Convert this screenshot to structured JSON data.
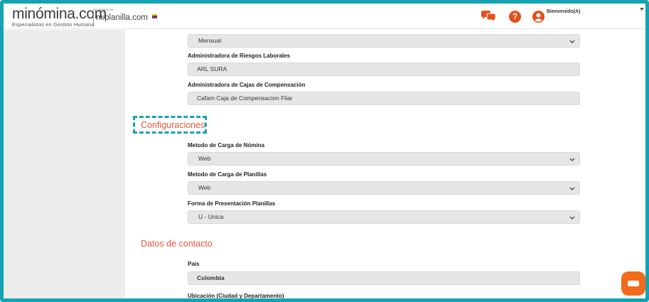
{
  "header": {
    "brand_name": "minómina.com",
    "brand_tagline": "Especialistas en Gestión Humana",
    "powered_label": "POWERED BY",
    "powered_name": "miplanilla.com",
    "welcome": "Bienvenido(A)"
  },
  "fields": {
    "frecuencia": {
      "value": "Mensual"
    },
    "arl": {
      "label": "Administradora de Riesgos Laborales",
      "value": "ARL SURA"
    },
    "caja": {
      "label": "Administradora de Cajas de Compensación",
      "value": "Cafam Caja de Compensacion Fliar"
    },
    "carga_nomina": {
      "label": "Metodo de Carga de Nómina",
      "value": "Web"
    },
    "carga_planillas": {
      "label": "Metodo de Carga de Planillas",
      "value": "Web"
    },
    "forma_presentacion": {
      "label": "Forma de Presentación Planillas",
      "value": "U - Unica"
    },
    "pais": {
      "label": "País",
      "value": "Colombia"
    },
    "ubicacion": {
      "label": "Ubicación (Ciudad y Departamento)"
    }
  },
  "sections": {
    "configuraciones": "Configuraciones",
    "contacto": "Datos de contacto"
  },
  "icons": {
    "chat": "chat-bubbles-icon",
    "help": "question-circle-icon",
    "user": "user-circle-icon",
    "caret": "chevron-down-icon",
    "fab": "support-chat-icon"
  },
  "colors": {
    "accent": "#e8583a",
    "icon_orange": "#e5501b",
    "frame": "#14a3b2",
    "fab": "#f26a1b",
    "field_bg": "#e6e6e6",
    "sidebar_bg": "#ececec"
  }
}
